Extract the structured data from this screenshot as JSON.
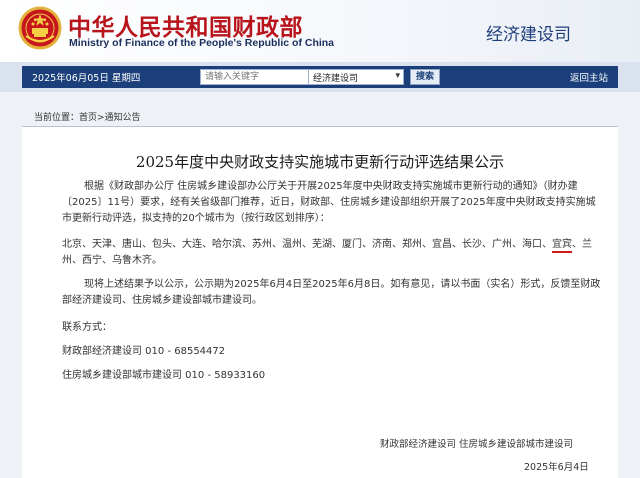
{
  "header": {
    "title_cn": "中华人民共和国财政部",
    "title_en": "Ministry of Finance of the People's Republic of China",
    "section": "经济建设司",
    "emblem_icon": "national-emblem-icon"
  },
  "navbar": {
    "date": "2025年06月05日  星期四",
    "search_placeholder": "请输入关键字",
    "search_scope": "经济建设司",
    "search_button": "搜索",
    "back_home": "返回主站"
  },
  "breadcrumb": "当前位置：首页>通知公告",
  "article": {
    "title": "2025年度中央财政支持实施城市更新行动评选结果公示",
    "para1": "根据《财政部办公厅 住房城乡建设部办公厅关于开展2025年度中央财政支持实施城市更新行动的通知》（财办建〔2025〕11号）要求，经有关省级部门推荐，近日，财政部、住房城乡建设部组织开展了2025年度中央财政支持实施城市更新行动评选，拟支持的20个城市为（按行政区划排序）：",
    "cities_before": "北京、天津、唐山、包头、大连、哈尔滨、苏州、温州、芜湖、厦门、济南、郑州、宜昌、长沙、广州、海口、",
    "cities_highlight": "宜宾",
    "cities_after": "、兰州、西宁、乌鲁木齐。",
    "notice": "现将上述结果予以公示，公示期为2025年6月4日至2025年6月8日。如有意见，请以书面（实名）形式，反馈至财政部经济建设司、住房城乡建设部城市建设司。",
    "contact_label": "联系方式：",
    "contact1": "财政部经济建设司   010 - 68554472",
    "contact2": "住房城乡建设部城市建设司  010 - 58933160",
    "signature": "财政部经济建设司    住房城乡建设部城市建设司",
    "date": "2025年6月4日"
  },
  "colors": {
    "title_red": "#b8141c",
    "nav_blue": "#1a3f7a",
    "underline_red": "#d21a1a"
  }
}
